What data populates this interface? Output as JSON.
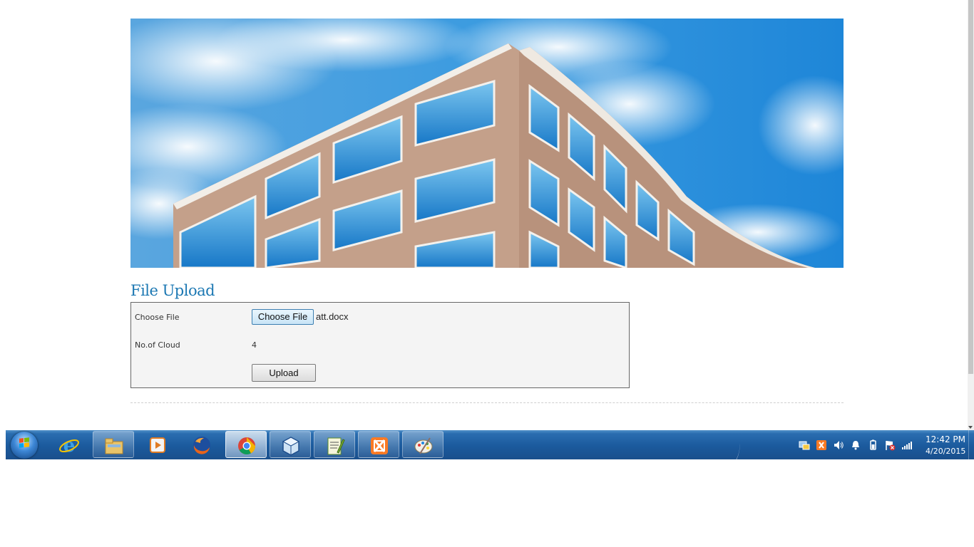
{
  "page": {
    "section_title": "File Upload"
  },
  "form": {
    "choose_file_label": "Choose File",
    "choose_file_button": "Choose File",
    "selected_file": "att.docx",
    "clouds_label": "No.of Cloud",
    "clouds_value": "4",
    "upload_button": "Upload"
  },
  "taskbar": {
    "apps": [
      "start-orb",
      "internet-explorer",
      "file-explorer",
      "media-player",
      "firefox",
      "chrome",
      "virtualbox",
      "notepad-plus-plus",
      "xampp",
      "paint"
    ],
    "tray_icons": [
      "network-config",
      "xampp",
      "volume",
      "notification",
      "battery",
      "action-center-flag",
      "signal"
    ],
    "time": "12:42 PM",
    "date": "4/20/2015"
  }
}
